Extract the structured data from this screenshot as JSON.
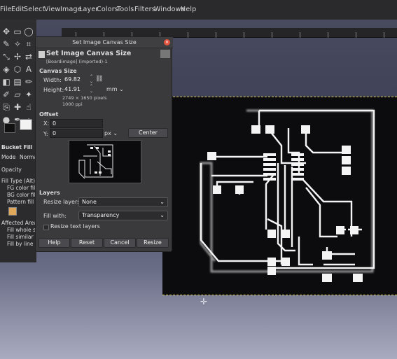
{
  "menu": [
    "File",
    "Edit",
    "Select",
    "View",
    "Image",
    "Layer",
    "Colors",
    "Tools",
    "Filters",
    "Windows",
    "Help"
  ],
  "dialog": {
    "window_title": "Set Image Canvas Size",
    "header_title": "Set Image Canvas Size",
    "header_subtitle": "[Boardimage] (imported)-1",
    "canvas_size_section": "Canvas Size",
    "width_label": "Width:",
    "width_value": "69.82",
    "height_label": "Height:",
    "height_value": "41.91",
    "unit": "mm",
    "pixels_info": "2749 × 1650 pixels",
    "ppi_info": "1000 ppi",
    "offset_section": "Offset",
    "x_label": "X:",
    "x_value": "0",
    "y_label": "Y:",
    "y_value": "0",
    "offset_unit": "px",
    "center_button": "Center",
    "layers_section": "Layers",
    "resize_layers_label": "Resize layers:",
    "resize_layers_value": "None",
    "fill_with_label": "Fill with:",
    "fill_with_value": "Transparency",
    "resize_text_layers": "Resize text layers",
    "help_button": "Help",
    "reset_button": "Reset",
    "cancel_button": "Cancel",
    "resize_button": "Resize"
  },
  "tool_options": {
    "title": "Bucket Fill",
    "mode_label": "Mode",
    "mode_value": "Normal",
    "opacity_label": "Opacity",
    "fill_type_label": "Fill Type (Alt)",
    "fg_color_fill": "FG color fill",
    "bg_color_fill": "BG color fill",
    "pattern_fill": "Pattern fill",
    "affected_area_label": "Affected Area (Shi",
    "fill_whole_selection": "Fill whole sel",
    "fill_similar_colors": "Fill similar col",
    "fill_by_line_art": "Fill by line art"
  },
  "colors": {
    "accent": "#e25440",
    "trace": "#f4f4f4",
    "canvas": "#0c0c0e",
    "selection": "#d9d257"
  }
}
